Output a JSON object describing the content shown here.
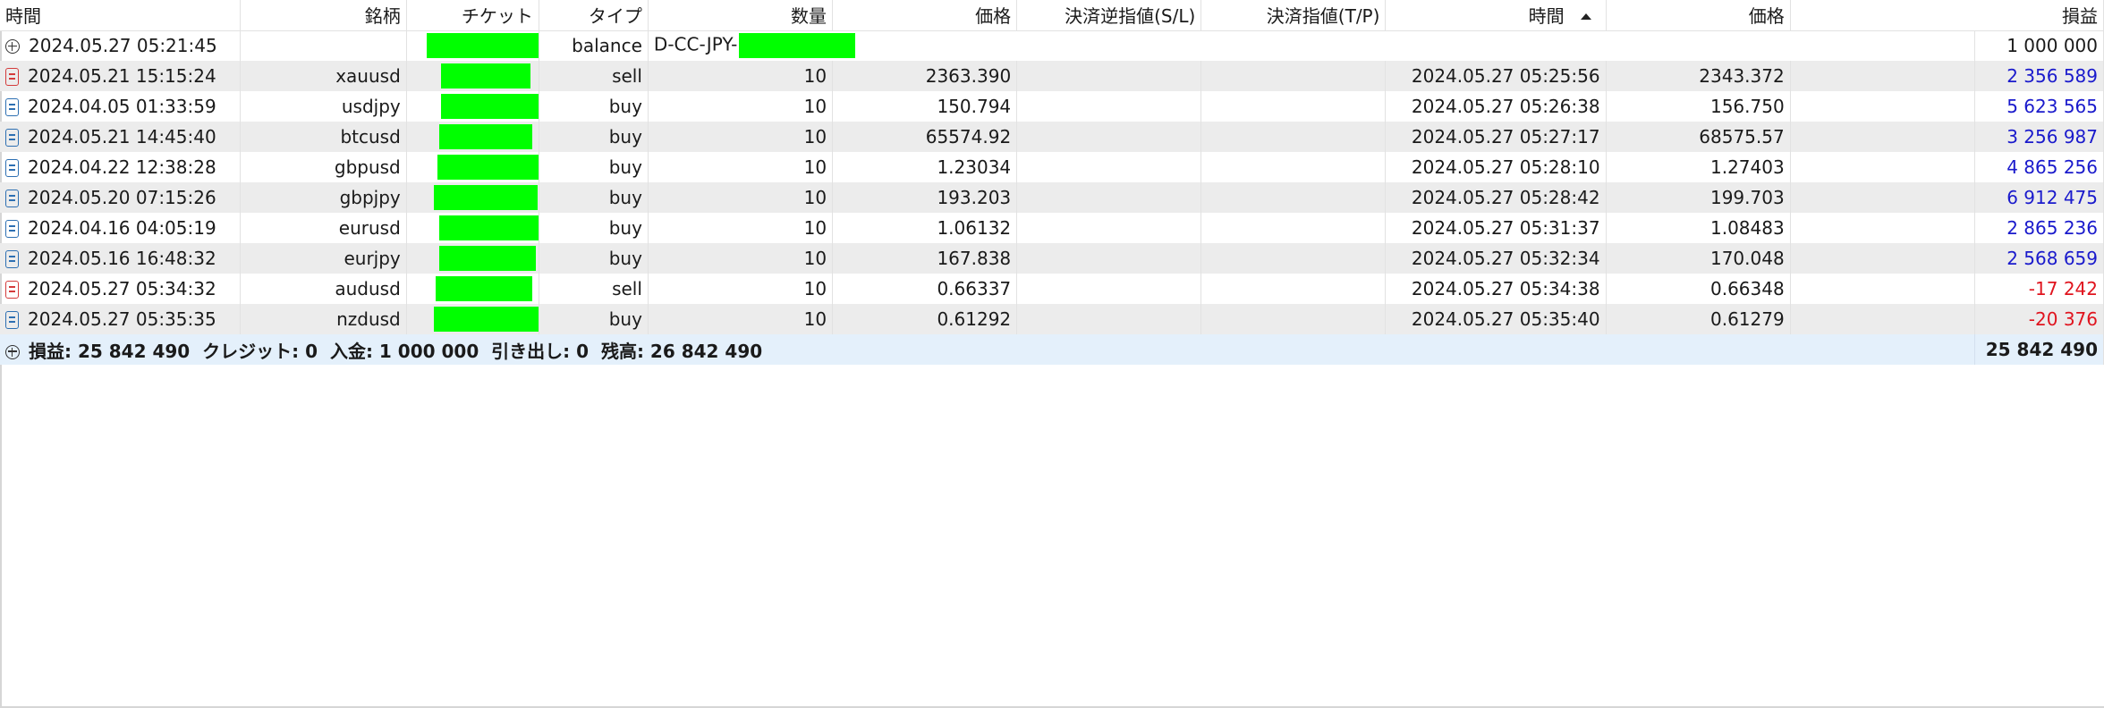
{
  "headers": {
    "time": "時間",
    "symbol": "銘柄",
    "ticket": "チケット",
    "type": "タイプ",
    "volume": "数量",
    "price": "価格",
    "sl": "決済逆指値(S/L)",
    "tp": "決済指値(T/P)",
    "close_time": "時間",
    "close_price": "価格",
    "profit": "損益"
  },
  "balance_row": {
    "time": "2024.05.27 05:21:45",
    "type": "balance",
    "comment": "D-CC-JPY-",
    "profit": "1 000 000"
  },
  "rows": [
    {
      "time": "2024.05.21 15:15:24",
      "symbol": "xauusd",
      "type": "sell",
      "volume": "10",
      "price": "2363.390",
      "close_time": "2024.05.27 05:25:56",
      "close_price": "2343.372",
      "profit": "2 356 589",
      "profit_sign": "pos"
    },
    {
      "time": "2024.04.05 01:33:59",
      "symbol": "usdjpy",
      "type": "buy",
      "volume": "10",
      "price": "150.794",
      "close_time": "2024.05.27 05:26:38",
      "close_price": "156.750",
      "profit": "5 623 565",
      "profit_sign": "pos"
    },
    {
      "time": "2024.05.21 14:45:40",
      "symbol": "btcusd",
      "type": "buy",
      "volume": "10",
      "price": "65574.92",
      "close_time": "2024.05.27 05:27:17",
      "close_price": "68575.57",
      "profit": "3 256 987",
      "profit_sign": "pos"
    },
    {
      "time": "2024.04.22 12:38:28",
      "symbol": "gbpusd",
      "type": "buy",
      "volume": "10",
      "price": "1.23034",
      "close_time": "2024.05.27 05:28:10",
      "close_price": "1.27403",
      "profit": "4 865 256",
      "profit_sign": "pos"
    },
    {
      "time": "2024.05.20 07:15:26",
      "symbol": "gbpjpy",
      "type": "buy",
      "volume": "10",
      "price": "193.203",
      "close_time": "2024.05.27 05:28:42",
      "close_price": "199.703",
      "profit": "6 912 475",
      "profit_sign": "pos"
    },
    {
      "time": "2024.04.16 04:05:19",
      "symbol": "eurusd",
      "type": "buy",
      "volume": "10",
      "price": "1.06132",
      "close_time": "2024.05.27 05:31:37",
      "close_price": "1.08483",
      "profit": "2 865 236",
      "profit_sign": "pos"
    },
    {
      "time": "2024.05.16 16:48:32",
      "symbol": "eurjpy",
      "type": "buy",
      "volume": "10",
      "price": "167.838",
      "close_time": "2024.05.27 05:32:34",
      "close_price": "170.048",
      "profit": "2 568 659",
      "profit_sign": "pos"
    },
    {
      "time": "2024.05.27 05:34:32",
      "symbol": "audusd",
      "type": "sell",
      "volume": "10",
      "price": "0.66337",
      "close_time": "2024.05.27 05:34:38",
      "close_price": "0.66348",
      "profit": "-17 242",
      "profit_sign": "neg"
    },
    {
      "time": "2024.05.27 05:35:35",
      "symbol": "nzdusd",
      "type": "buy",
      "volume": "10",
      "price": "0.61292",
      "close_time": "2024.05.27 05:35:40",
      "close_price": "0.61279",
      "profit": "-20 376",
      "profit_sign": "neg"
    }
  ],
  "summary": {
    "text": "損益: 25 842 490  クレジット: 0  入金: 1 000 000  引き出し: 0  残高: 26 842 490",
    "total": "25 842 490"
  },
  "colors": {
    "positive_profit": "#1a1acc",
    "negative_profit": "#e0141e",
    "redaction_mask": "#00ff00",
    "summary_bg": "#e4f0fb"
  },
  "icons": {
    "buy_row": "deal-buy-icon",
    "sell_row": "deal-sell-icon",
    "balance_row": "add-circle-icon",
    "sort": "sort-ascending-icon"
  }
}
